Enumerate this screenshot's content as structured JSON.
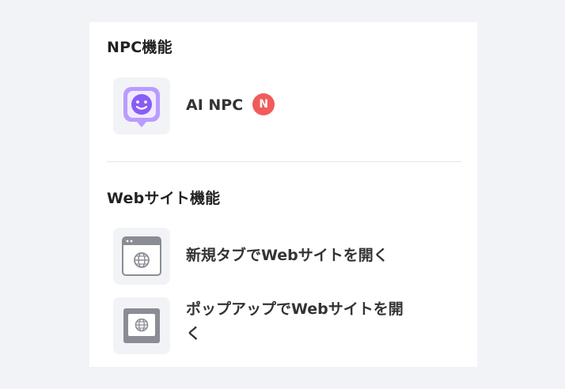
{
  "sections": [
    {
      "title": "NPC機能",
      "items": [
        {
          "label": "AI NPC",
          "badge": "N",
          "icon": "ai-npc-icon"
        }
      ]
    },
    {
      "title": "Webサイト機能",
      "items": [
        {
          "label": "新規タブでWebサイトを開く",
          "icon": "browser-window-globe-icon"
        },
        {
          "label_line1": "ポップアップでWebサイトを開",
          "label_line2": "く",
          "icon": "popup-window-globe-icon"
        }
      ]
    }
  ],
  "colors": {
    "background": "#f1f3f7",
    "panel": "#ffffff",
    "accent_purple": "#8a5cf5",
    "badge_red": "#f15b5b"
  }
}
